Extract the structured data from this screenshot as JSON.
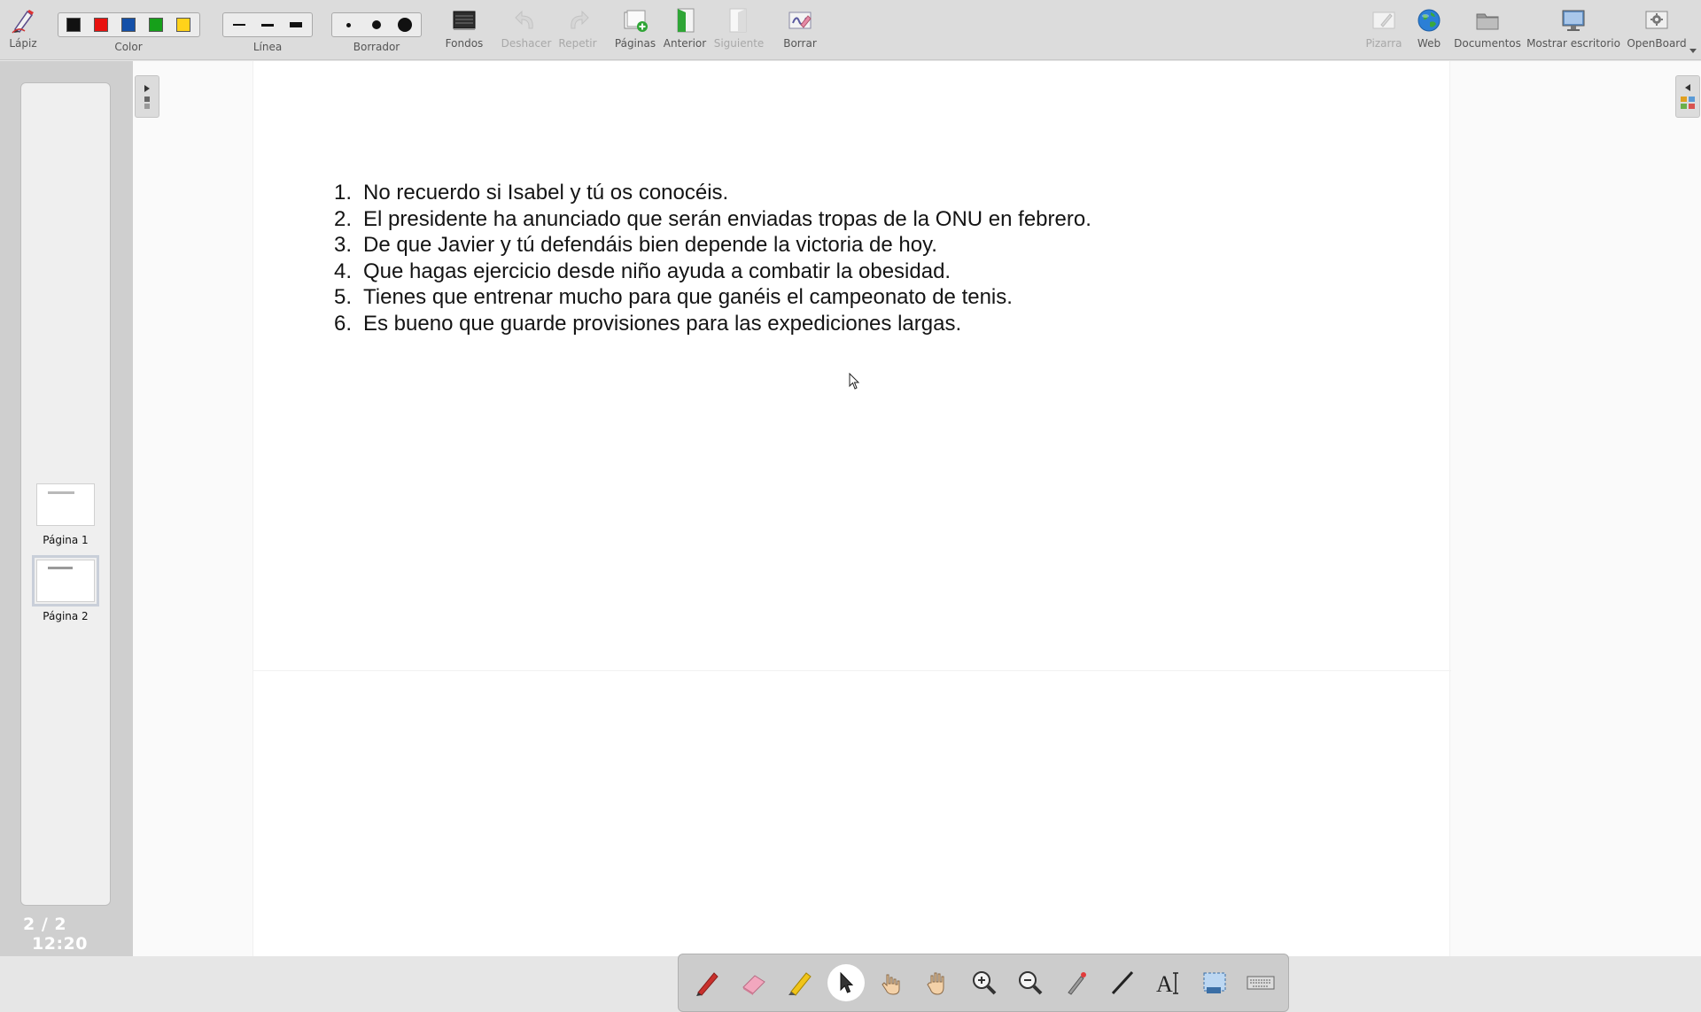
{
  "toolbar": {
    "pen_label": "Lápiz",
    "color_label": "Color",
    "colors": [
      "#111111",
      "#e8120f",
      "#1450a8",
      "#16a01a",
      "#ffd21a"
    ],
    "line_label": "Línea",
    "eraser_label": "Borrador",
    "backgrounds_label": "Fondos",
    "undo_label": "Deshacer",
    "redo_label": "Repetir",
    "pages_label": "Páginas",
    "previous_label": "Anterior",
    "next_label": "Siguiente",
    "clear_label": "Borrar",
    "board_label": "Pizarra",
    "web_label": "Web",
    "documents_label": "Documentos",
    "desktop_label": "Mostrar escritorio",
    "openboard_label": "OpenBoard"
  },
  "sidebar": {
    "pages": [
      {
        "label": "Página 1",
        "selected": false
      },
      {
        "label": "Página 2",
        "selected": true
      }
    ],
    "page_counter": "2 / 2",
    "clock": "12:20"
  },
  "board": {
    "items": [
      {
        "num": "1.",
        "text": "No recuerdo si Isabel y tú os conocéis."
      },
      {
        "num": "2.",
        "text": "El presidente ha anunciado que serán enviadas tropas de la ONU en febrero."
      },
      {
        "num": "3.",
        "text": "De que Javier y tú defendáis bien depende la victoria de hoy."
      },
      {
        "num": "4.",
        "text": "Que hagas ejercicio desde niño ayuda a combatir la obesidad."
      },
      {
        "num": "5.",
        "text": "Tienes que entrenar mucho para que ganéis el campeonato de tenis."
      },
      {
        "num": "6.",
        "text": "Es bueno que guarde provisiones para las expediciones largas."
      }
    ]
  },
  "dock": {
    "tools": [
      "pen-icon",
      "eraser-icon",
      "highlighter-icon",
      "select-pointer-icon",
      "play-hand-icon",
      "hand-icon",
      "zoom-in-icon",
      "zoom-out-icon",
      "laser-pointer-icon",
      "line-icon",
      "text-icon",
      "capture-icon",
      "keyboard-icon"
    ],
    "active_tool": "select-pointer-icon"
  }
}
